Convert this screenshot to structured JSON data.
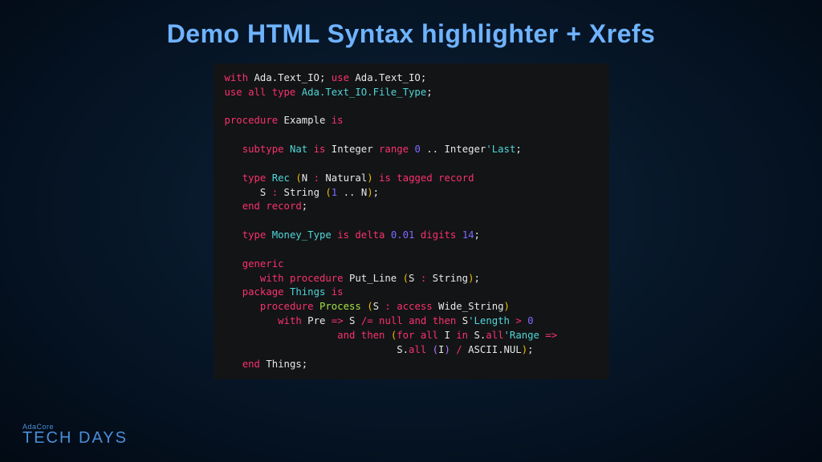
{
  "slide": {
    "title": "Demo HTML Syntax highlighter + Xrefs"
  },
  "footer": {
    "brand_small": "AdaCore",
    "brand_large": "TECH DAYS"
  },
  "code": {
    "line1": {
      "t1": "with",
      "t2": " Ada.Text_IO",
      "t3": "; ",
      "t4": "use",
      "t5": " Ada.Text_IO",
      "t6": ";"
    },
    "line2": {
      "t1": "use all type",
      "t2": " Ada.Text_IO.File_Type",
      "t3": ";"
    },
    "line3": "",
    "line4": {
      "t1": "procedure",
      "t2": " Example ",
      "t3": "is"
    },
    "line5": "",
    "line6": {
      "t0": "   ",
      "t1": "subtype",
      "t2": " Nat ",
      "t3": "is",
      "t4": " Integer ",
      "t5": "range",
      "t6": " 0 ",
      "t7": ".. ",
      "t8": "Integer",
      "t9": "'Last",
      "t10": ";"
    },
    "line7": "",
    "line8": {
      "t0": "   ",
      "t1": "type",
      "t2": " Rec ",
      "t3": "(",
      "t4": "N ",
      "t5": ": ",
      "t6": "Natural",
      "t7": ")",
      "t8": " is ",
      "t9": "tagged record"
    },
    "line9": {
      "t0": "      ",
      "t1": "S ",
      "t2": ": ",
      "t3": "String ",
      "t4": "(",
      "t5": "1 ",
      "t6": ".. ",
      "t7": "N",
      "t8": ")",
      "t9": ";"
    },
    "line10": {
      "t0": "   ",
      "t1": "end record",
      "t2": ";"
    },
    "line11": "",
    "line12": {
      "t0": "   ",
      "t1": "type",
      "t2": " Money_Type ",
      "t3": "is",
      "t4": " delta ",
      "t5": "0.01 ",
      "t6": "digits ",
      "t7": "14",
      "t8": ";"
    },
    "line13": "",
    "line14": {
      "t0": "   ",
      "t1": "generic"
    },
    "line15": {
      "t0": "      ",
      "t1": "with procedure",
      "t2": " Put_Line ",
      "t3": "(",
      "t4": "S ",
      "t5": ": ",
      "t6": "String",
      "t7": ")",
      "t8": ";"
    },
    "line16": {
      "t0": "   ",
      "t1": "package",
      "t2": " Things ",
      "t3": "is"
    },
    "line17": {
      "t0": "      ",
      "t1": "procedure",
      "t2": " Process ",
      "t3": "(",
      "t4": "S ",
      "t5": ": ",
      "t6": "access",
      "t7": " Wide_String",
      "t8": ")"
    },
    "line18": {
      "t0": "         ",
      "t1": "with",
      "t2": " Pre ",
      "t3": "=> ",
      "t4": "S ",
      "t5": "/= ",
      "t6": "null ",
      "t7": "and then ",
      "t8": "S",
      "t9": "'Length",
      "t10": " > ",
      "t11": "0"
    },
    "line19": {
      "t0": "                   ",
      "t1": "and then ",
      "t2": "(",
      "t3": "for all",
      "t4": " I ",
      "t5": "in",
      "t6": " S.",
      "t7": "all",
      "t8": "'Range",
      "t9": " =>"
    },
    "line20": {
      "t0": "                             ",
      "t1": "S.",
      "t2": "all ",
      "t3": "(",
      "t4": "I",
      "t5": ")",
      "t6": " /",
      "t7": " ASCII.NUL",
      "t8": ")",
      "t9": ";"
    },
    "line21": {
      "t0": "   ",
      "t1": "end",
      "t2": " Things",
      "t3": ";"
    }
  }
}
